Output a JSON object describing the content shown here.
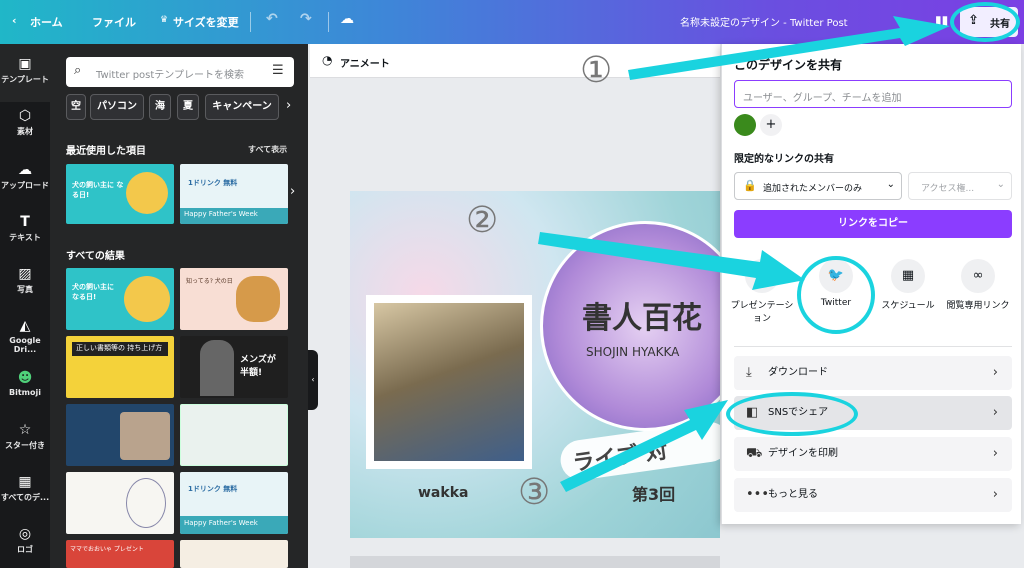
{
  "topbar": {
    "home": "ホーム",
    "file": "ファイル",
    "resize": "サイズを変更",
    "title": "名称未設定のデザイン - Twitter Post",
    "share_button": "共有"
  },
  "rail": [
    {
      "label": "テンプレート",
      "icon": "template-icon"
    },
    {
      "label": "素材",
      "icon": "elements-icon"
    },
    {
      "label": "アップロード",
      "icon": "upload-icon"
    },
    {
      "label": "テキスト",
      "icon": "text-icon"
    },
    {
      "label": "写真",
      "icon": "photo-icon"
    },
    {
      "label": "Google Dri...",
      "icon": "google-drive-icon"
    },
    {
      "label": "Bitmoji",
      "icon": "bitmoji-icon"
    },
    {
      "label": "スター付き",
      "icon": "star-icon"
    },
    {
      "label": "すべてのデ...",
      "icon": "grid-icon"
    },
    {
      "label": "ロゴ",
      "icon": "logo-icon"
    }
  ],
  "panel": {
    "search_placeholder": "Twitter postテンプレートを検索",
    "chips": [
      "空",
      "パソコン",
      "海",
      "夏",
      "キャンペーン"
    ],
    "recent_title": "最近使用した項目",
    "see_all": "すべて表示",
    "all_results": "すべての結果",
    "thumb_texts": {
      "t1": "犬の飼い主に なる日!",
      "t2": "1ドリンク 無料",
      "t2b": "Happy Father's Week",
      "t3": "犬の飼い主に なる日!",
      "t4": "知ってる? 犬の日",
      "t5": "正しい書類等の 持ち上げ方",
      "t6": "メンズが 半額!",
      "t7": "1ドリンク 無料",
      "t7b": "Happy Father's Week",
      "t8": "ママでおおいゃ プレゼント"
    }
  },
  "canvasbar": {
    "animate": "アニメート"
  },
  "design": {
    "title": "書人百花",
    "subtitle": "SHOJIN HYAKKA",
    "banner": "ライブ 対",
    "episode": "第3回",
    "name": "wakka"
  },
  "share": {
    "heading": "このデザインを共有",
    "invite_placeholder": "ユーザー、グループ、チームを追加",
    "link_section": "限定的なリンクの共有",
    "access_scope": "追加されたメンバーのみ",
    "access_level": "アクセス権...",
    "copy_link": "リンクをコピー",
    "options": [
      "プレゼンテーション",
      "Twitter",
      "スケジュール",
      "閲覧専用リンク"
    ],
    "menu": [
      "ダウンロード",
      "SNSでシェア",
      "デザインを印刷",
      "もっと見る"
    ]
  },
  "annotations": [
    "①",
    "②",
    "③"
  ],
  "colors": {
    "accent": "#8b3dff",
    "annotation": "#1ad3df",
    "avatar": "#3a8a1c"
  }
}
